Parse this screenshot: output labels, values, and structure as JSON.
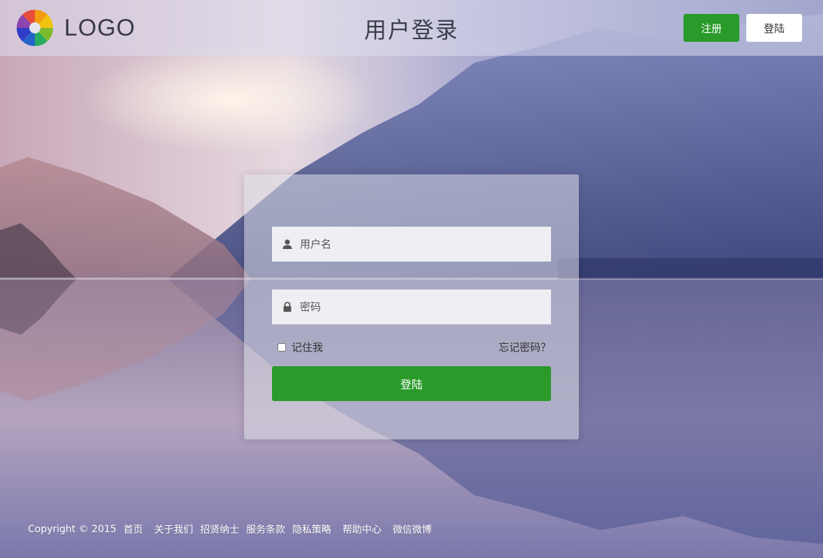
{
  "header": {
    "logo_text": "LOGO",
    "title": "用户登录",
    "register_label": "注册",
    "login_label": "登陆"
  },
  "login_form": {
    "username_placeholder": "用户名",
    "password_placeholder": "密码",
    "remember_label": "记住我",
    "forgot_label": "忘记密码？",
    "submit_label": "登陆"
  },
  "footer": {
    "copyright": "Copyright  © 2015",
    "links": [
      "首页",
      "关于我们",
      "招贤纳士",
      "服务条款",
      "隐私策略",
      "帮助中心",
      "微信微博"
    ]
  },
  "colors": {
    "accent_green": "#2a9a2a",
    "header_bg": "#dcdcee",
    "card_bg": "#dcdce6"
  },
  "icons": {
    "logo": "colorful-swirl-logo",
    "user": "user-icon",
    "lock": "lock-icon"
  }
}
